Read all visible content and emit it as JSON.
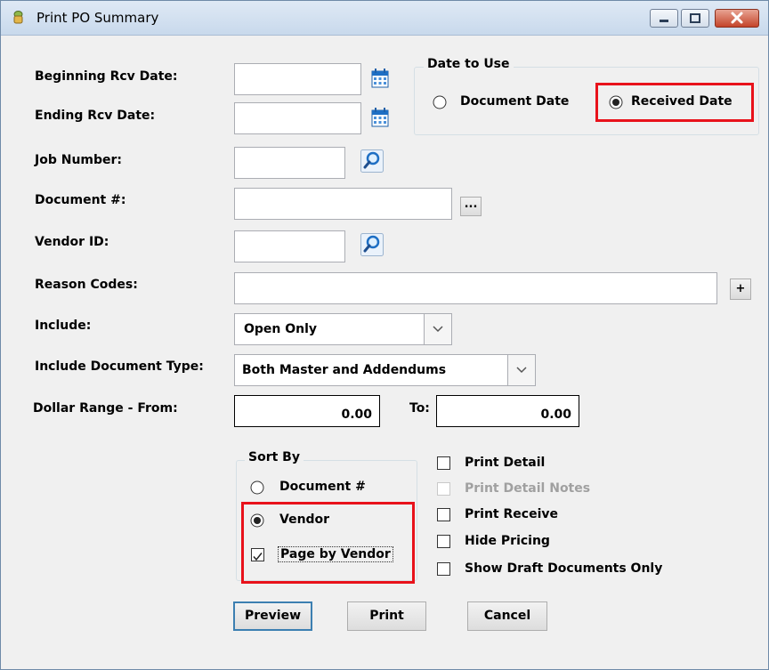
{
  "window": {
    "title": "Print PO Summary"
  },
  "labels": {
    "beginning_rcv_date": "Beginning Rcv Date:",
    "ending_rcv_date": "Ending Rcv Date:",
    "job_number": "Job Number:",
    "document_no": "Document #:",
    "vendor_id": "Vendor ID:",
    "reason_codes": "Reason Codes:",
    "include": "Include:",
    "include_document_type": "Include Document Type:",
    "dollar_range_from": "Dollar Range - From:",
    "to": "To:"
  },
  "fields": {
    "beginning_rcv_date": "",
    "ending_rcv_date": "",
    "job_number": "",
    "document_no": "",
    "vendor_id": "",
    "reason_codes": "",
    "include": "Open Only",
    "include_document_type": "Both Master and Addendums",
    "dollar_from": "0.00",
    "dollar_to": "0.00"
  },
  "date_to_use": {
    "title": "Date to Use",
    "options": [
      {
        "label": "Document Date",
        "selected": false
      },
      {
        "label": "Received Date",
        "selected": true
      }
    ]
  },
  "sort_by": {
    "title": "Sort By",
    "options": [
      {
        "label": "Document #",
        "selected": false
      },
      {
        "label": "Vendor",
        "selected": true
      }
    ],
    "page_by_vendor": {
      "label": "Page by Vendor",
      "checked": true
    }
  },
  "checkboxes": [
    {
      "label": "Print Detail",
      "checked": false,
      "enabled": true
    },
    {
      "label": "Print Detail Notes",
      "checked": false,
      "enabled": false
    },
    {
      "label": "Print Receive",
      "checked": false,
      "enabled": true
    },
    {
      "label": "Hide Pricing",
      "checked": false,
      "enabled": true
    },
    {
      "label": "Show Draft Documents Only",
      "checked": false,
      "enabled": true
    }
  ],
  "buttons": {
    "ellipsis": "...",
    "plus": "+",
    "preview": "Preview",
    "print": "Print",
    "cancel": "Cancel"
  },
  "colors": {
    "highlight": "#e8121b",
    "default_button_border": "#3c7fb1"
  }
}
